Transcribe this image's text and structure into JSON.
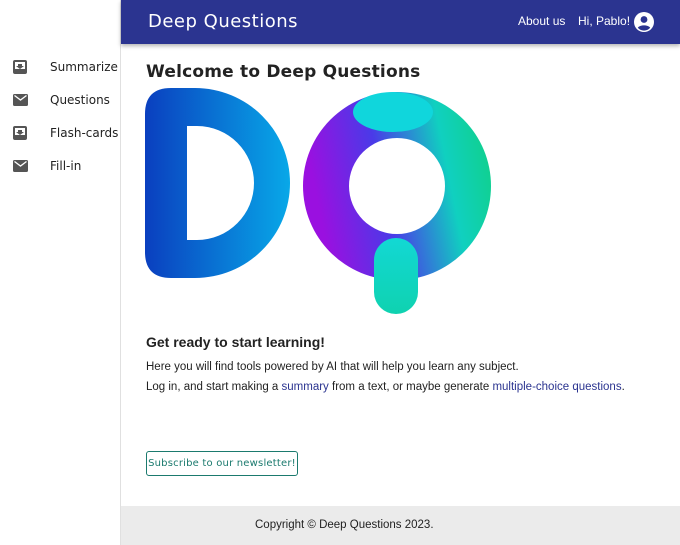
{
  "header": {
    "brand": "Deep Questions",
    "about_label": "About us",
    "greeting": "Hi, Pablo!",
    "avatar_icon": "account-circle-icon",
    "bar_color": "#2b3490"
  },
  "sidebar": {
    "items": [
      {
        "label": "Summarize",
        "icon": "move-to-inbox-icon"
      },
      {
        "label": "Questions",
        "icon": "mail-icon"
      },
      {
        "label": "Flash-cards",
        "icon": "move-to-inbox-icon"
      },
      {
        "label": "Fill-in",
        "icon": "mail-icon"
      }
    ]
  },
  "main": {
    "welcome_title": "Welcome to Deep Questions",
    "logo_name": "DQ-logo",
    "subtitle": "Get ready to start learning!",
    "paragraph1": "Here you will find tools powered by AI that will help you learn any subject.",
    "paragraph2_before": "Log in, and start making a ",
    "paragraph2_link1": "summary",
    "paragraph2_middle": " from a text, or maybe generate ",
    "paragraph2_link2": "multiple-choice questions",
    "paragraph2_after": ".",
    "newsletter_label": "Subscribe to our newsletter!",
    "accent_color": "#1b7a6e"
  },
  "footer": {
    "copyright": "Copyright © Deep Questions 2023."
  }
}
